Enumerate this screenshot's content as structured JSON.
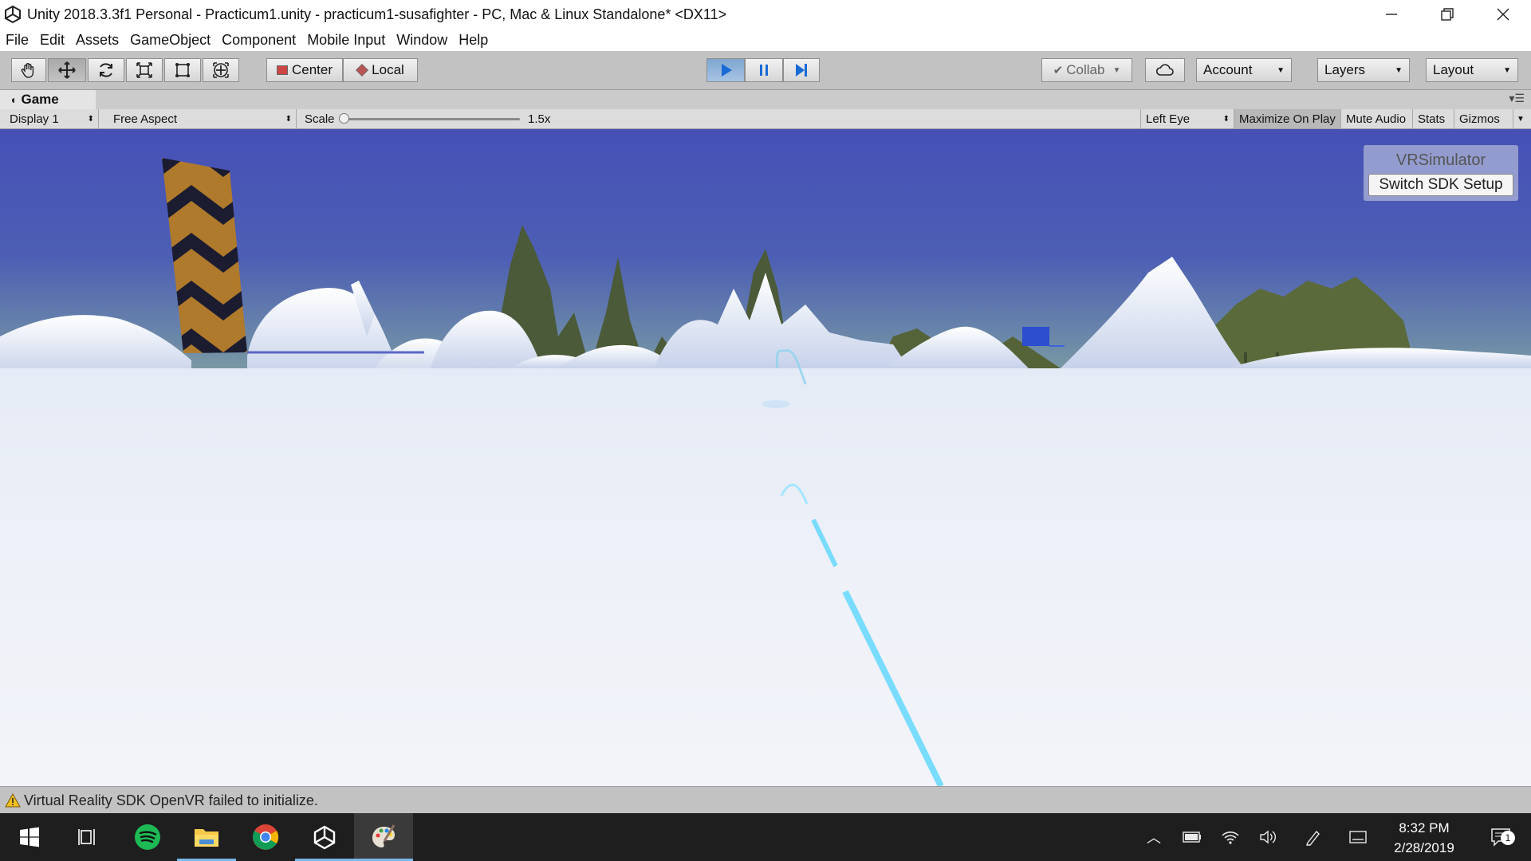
{
  "window": {
    "title": "Unity 2018.3.3f1 Personal - Practicum1.unity - practicum1-susafighter - PC, Mac & Linux Standalone* <DX11>",
    "controls": [
      "minimize",
      "maximize",
      "close"
    ]
  },
  "menu": [
    "File",
    "Edit",
    "Assets",
    "GameObject",
    "Component",
    "Mobile Input",
    "Window",
    "Help"
  ],
  "toolbar": {
    "tools": [
      {
        "name": "hand-tool",
        "active": false
      },
      {
        "name": "move-tool",
        "active": true
      },
      {
        "name": "rotate-tool",
        "active": false
      },
      {
        "name": "scale-tool",
        "active": false
      },
      {
        "name": "rect-tool",
        "active": false
      },
      {
        "name": "transform-tool",
        "active": false
      }
    ],
    "pivot_label": "Center",
    "space_label": "Local",
    "play_state": "playing",
    "collab_label": "Collab",
    "account_label": "Account",
    "layers_label": "Layers",
    "layout_label": "Layout"
  },
  "game_view": {
    "tab_label": "Game",
    "display": "Display 1",
    "aspect": "Free Aspect",
    "scale_label": "Scale",
    "scale_value": "1.5x",
    "scale_slider_position": 0,
    "eye": "Left Eye",
    "maximize_on_play": "Maximize On Play",
    "mute_audio": "Mute Audio",
    "stats": "Stats",
    "gizmos": "Gizmos"
  },
  "vr_simulator": {
    "title": "VRSimulator",
    "button": "Switch SDK Setup"
  },
  "status": {
    "message": "Virtual Reality SDK OpenVR failed to initialize."
  },
  "taskbar": {
    "apps": [
      "start",
      "task-view",
      "spotify",
      "file-explorer",
      "chrome",
      "unity",
      "paint"
    ],
    "time": "8:32 PM",
    "date": "2/28/2019",
    "notifications": "1"
  },
  "colors": {
    "sky_top": "#4a55b8",
    "horizon": "#86a7a0",
    "snow": "#eef1f8",
    "pointer": "#79dcff",
    "accent": "#76b9ed"
  }
}
